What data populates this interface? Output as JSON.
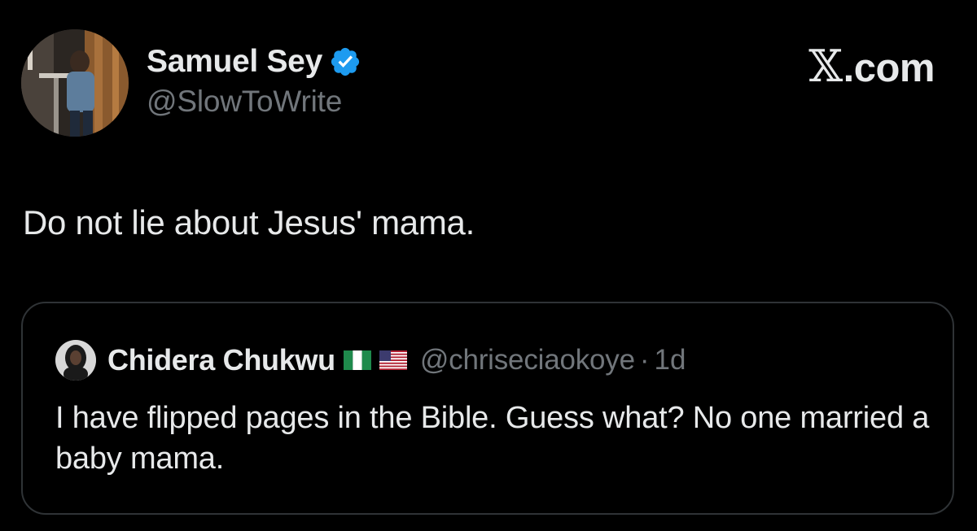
{
  "tweet": {
    "author": {
      "display_name": "Samuel Sey",
      "handle": "@SlowToWrite",
      "verified_icon": "verified-badge-icon",
      "verified_color": "#1d9bf0"
    },
    "brand": {
      "logo_glyph": "𝕏",
      "domain": ".com"
    },
    "text": "Do not lie about Jesus' mama.",
    "quoted": {
      "display_name": "Chidera Chukwu",
      "flags": [
        "nigeria-flag-icon",
        "usa-flag-icon"
      ],
      "handle": "@chriseciaokoye",
      "separator": "·",
      "time": "1d",
      "text": "I have flipped pages in the Bible. Guess what? No one married a baby mama."
    }
  },
  "colors": {
    "background": "#000000",
    "primary_text": "#e7e9ea",
    "secondary_text": "#71767b",
    "border": "#2f3336",
    "accent": "#1d9bf0"
  }
}
